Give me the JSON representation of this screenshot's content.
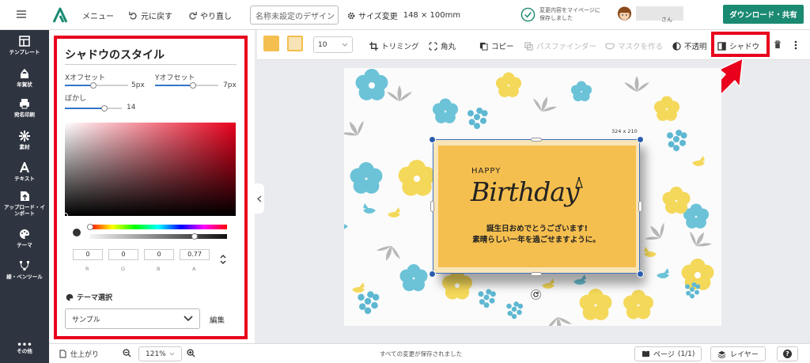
{
  "topbar": {
    "menu": "メニュー",
    "undo": "元に戻す",
    "redo": "やり直し",
    "design_name_placeholder": "名称未設定のデザイン",
    "size_change": "サイズ変更",
    "size_value": "148 × 100mm",
    "saved_line1": "変更内容をマイページに",
    "saved_line2": "保存しました",
    "user_suffix": "さん",
    "download": "ダウンロード・共有"
  },
  "sidebar": {
    "items": [
      {
        "label": "テンプレート",
        "icon": "template-icon"
      },
      {
        "label": "年賀状",
        "icon": "newyear-card-icon"
      },
      {
        "label": "宛名印刷",
        "icon": "printer-icon"
      },
      {
        "label": "素材",
        "icon": "material-icon"
      },
      {
        "label": "テキスト",
        "icon": "text-icon"
      },
      {
        "label": "アップロード・インポート",
        "icon": "upload-icon"
      },
      {
        "label": "テーマ",
        "icon": "palette-icon"
      },
      {
        "label": "線・ペンツール",
        "icon": "pen-tool-icon"
      },
      {
        "label": "その他",
        "icon": "more-icon"
      }
    ]
  },
  "shadow": {
    "title": "シャドウのスタイル",
    "x_offset_label": "Xオフセット",
    "x_offset_value": "5px",
    "x_offset_level": 0.45,
    "y_offset_label": "Yオフセット",
    "y_offset_value": "7px",
    "y_offset_level": 0.6,
    "blur_label": "ぼかし",
    "blur_value": "14",
    "blur_level": 0.7,
    "color": "#000000",
    "r": "0",
    "g": "0",
    "b": "0",
    "a": "0.77",
    "r_label": "R",
    "g_label": "G",
    "b_label": "B",
    "a_label": "A",
    "theme_label": "テーマ選択",
    "theme_value": "サンプル",
    "edit": "編集"
  },
  "toolbar": {
    "fill_color": "#f5bf4f",
    "secondary_color": "#f7e3b5",
    "font_size": "10",
    "trim": "トリミング",
    "corner": "角丸",
    "copy": "コピー",
    "pathfinder": "パスファインダー",
    "mask": "マスクを作る",
    "opacity": "不透明",
    "shadow": "シャドウ"
  },
  "canvas": {
    "card_size": "324 x 210",
    "happy": "HAPPY",
    "birthday": "Birthday",
    "message_line1": "誕生日おめでとうございます!",
    "message_line2": "素晴らしい一年を過ごせますように。",
    "card_color": "#f5bf4f"
  },
  "bottombar": {
    "finish": "仕上がり",
    "zoom": "121%",
    "status": "すべての変更が保存されました",
    "page": "ページ",
    "page_count": "(1/1)",
    "layer": "レイヤー",
    "help": "?"
  },
  "colors": {
    "accent": "#1a8a72",
    "highlight": "#e8001c",
    "sidebar_bg": "#2f3540",
    "slider": "#3275c9"
  }
}
